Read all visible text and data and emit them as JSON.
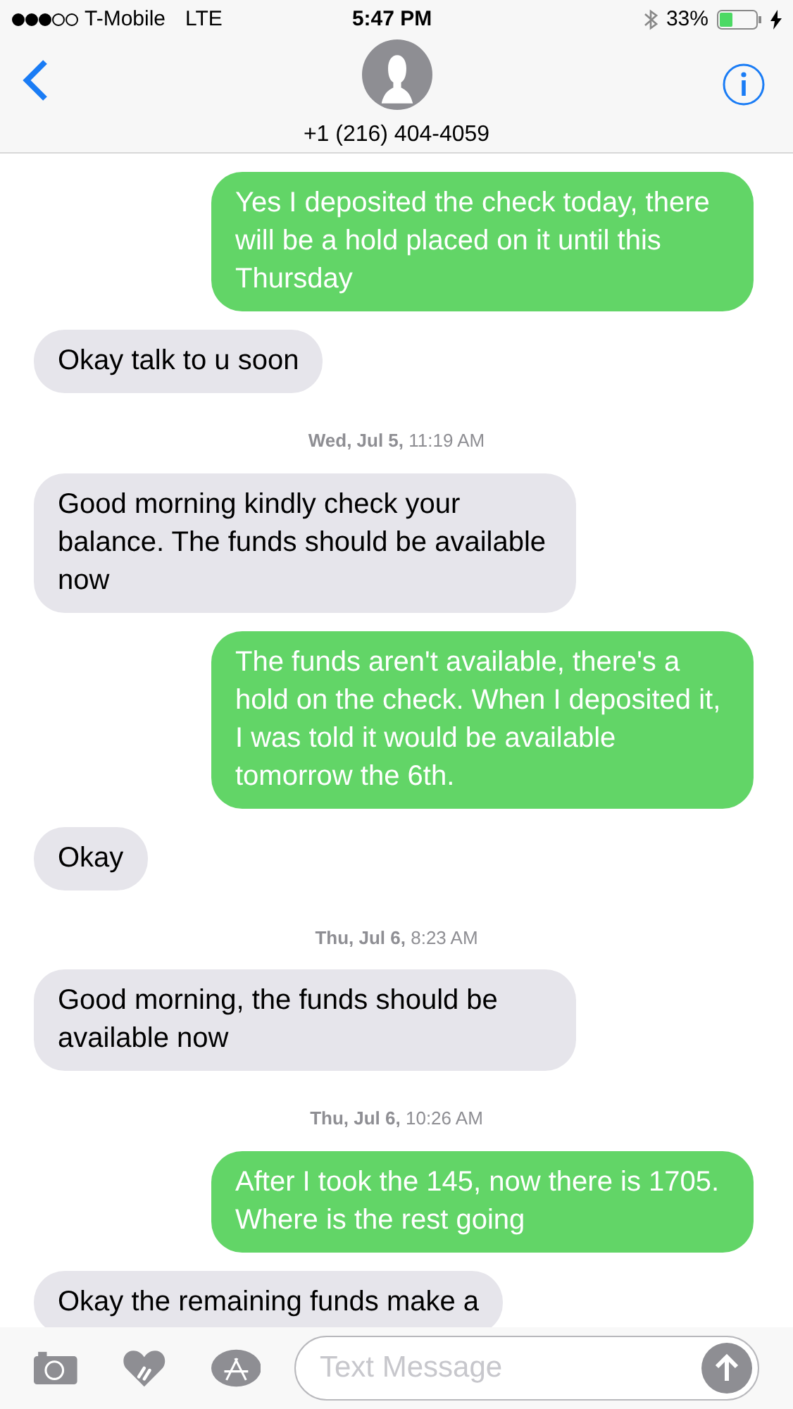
{
  "status_bar": {
    "carrier": "T-Mobile",
    "network": "LTE",
    "time": "5:47 PM",
    "battery": "33%"
  },
  "header": {
    "contact": "+1 (216) 404-4059"
  },
  "messages": [
    {
      "kind": "sent",
      "text": "Yes I deposited the check today, there will be a hold placed on it until this Thursday"
    },
    {
      "kind": "received",
      "text": "Okay talk to u soon"
    },
    {
      "kind": "timestamp",
      "day": "Wed, Jul 5,",
      "time": "11:19 AM"
    },
    {
      "kind": "received",
      "text": "Good morning kindly check your balance. The funds should be available now"
    },
    {
      "kind": "sent",
      "text": "The funds aren't available, there's a hold on the check. When I deposited it, I was told it would be available tomorrow the 6th."
    },
    {
      "kind": "received",
      "text": "Okay"
    },
    {
      "kind": "timestamp",
      "day": "Thu, Jul 6,",
      "time": "8:23 AM"
    },
    {
      "kind": "received",
      "text": "Good morning, the funds should be available now"
    },
    {
      "kind": "timestamp",
      "day": "Thu, Jul 6,",
      "time": "10:26 AM"
    },
    {
      "kind": "sent",
      "text": "After I took the 145, now there is 1705. Where is the rest going"
    },
    {
      "kind": "received",
      "text": "Okay the remaining funds make a"
    }
  ],
  "composer": {
    "placeholder": "Text Message"
  }
}
